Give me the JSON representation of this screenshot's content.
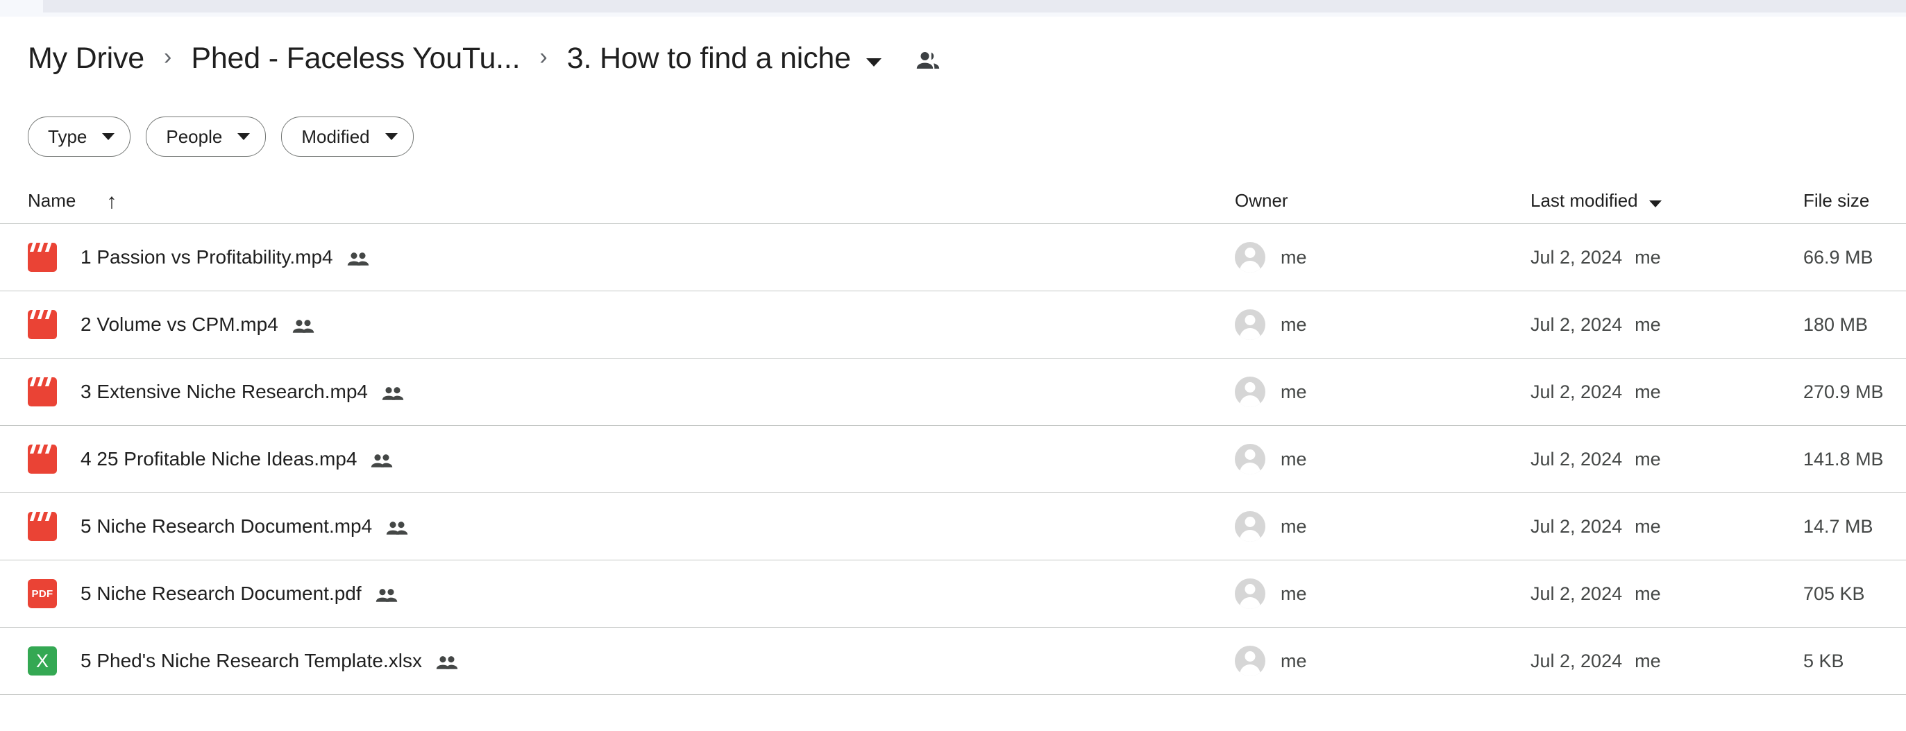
{
  "breadcrumb": {
    "separator": "›",
    "items": [
      {
        "label": "My Drive"
      },
      {
        "label": "Phed - Faceless YouTu..."
      },
      {
        "label": "3. How to find a niche"
      }
    ],
    "people_icon": "people-icon",
    "dropdown_icon": "chevron-down-icon"
  },
  "filters": [
    {
      "label": "Type",
      "icon": "chevron-down-icon"
    },
    {
      "label": "People",
      "icon": "chevron-down-icon"
    },
    {
      "label": "Modified",
      "icon": "chevron-down-icon"
    }
  ],
  "table": {
    "columns": {
      "name": "Name",
      "owner": "Owner",
      "last_modified": "Last modified",
      "file_size": "File size"
    },
    "sort": {
      "name_arrow": "↑",
      "modified_caret": "chevron-down-icon"
    },
    "rows": [
      {
        "icon": "video-file-icon",
        "icon_type": "video",
        "icon_label": "",
        "name": "1 Passion vs Profitability.mp4",
        "shared_icon": "shared-people-icon",
        "owner": "me",
        "last_modified": "Jul 2, 2024",
        "modified_by": "me",
        "file_size": "66.9 MB"
      },
      {
        "icon": "video-file-icon",
        "icon_type": "video",
        "icon_label": "",
        "name": "2 Volume vs CPM.mp4",
        "shared_icon": "shared-people-icon",
        "owner": "me",
        "last_modified": "Jul 2, 2024",
        "modified_by": "me",
        "file_size": "180 MB"
      },
      {
        "icon": "video-file-icon",
        "icon_type": "video",
        "icon_label": "",
        "name": "3 Extensive Niche Research.mp4",
        "shared_icon": "shared-people-icon",
        "owner": "me",
        "last_modified": "Jul 2, 2024",
        "modified_by": "me",
        "file_size": "270.9 MB"
      },
      {
        "icon": "video-file-icon",
        "icon_type": "video",
        "icon_label": "",
        "name": "4 25 Profitable Niche Ideas.mp4",
        "shared_icon": "shared-people-icon",
        "owner": "me",
        "last_modified": "Jul 2, 2024",
        "modified_by": "me",
        "file_size": "141.8 MB"
      },
      {
        "icon": "video-file-icon",
        "icon_type": "video",
        "icon_label": "",
        "name": "5 Niche Research Document.mp4",
        "shared_icon": "shared-people-icon",
        "owner": "me",
        "last_modified": "Jul 2, 2024",
        "modified_by": "me",
        "file_size": "14.7 MB"
      },
      {
        "icon": "pdf-file-icon",
        "icon_type": "pdf",
        "icon_label": "PDF",
        "name": "5 Niche Research Document.pdf",
        "shared_icon": "shared-people-icon",
        "owner": "me",
        "last_modified": "Jul 2, 2024",
        "modified_by": "me",
        "file_size": "705 KB"
      },
      {
        "icon": "spreadsheet-file-icon",
        "icon_type": "xls",
        "icon_label": "X",
        "name": "5 Phed's Niche Research Template.xlsx",
        "shared_icon": "shared-people-icon",
        "owner": "me",
        "last_modified": "Jul 2, 2024",
        "modified_by": "me",
        "file_size": "5 KB"
      }
    ]
  },
  "colors": {
    "video_red": "#ea4335",
    "pdf_red": "#ea4335",
    "excel_green": "#34a853",
    "text_primary": "#1f1f1f",
    "text_secondary": "#444746",
    "divider": "#c4c7c5",
    "chrome_bg": "#e8eaf1"
  }
}
